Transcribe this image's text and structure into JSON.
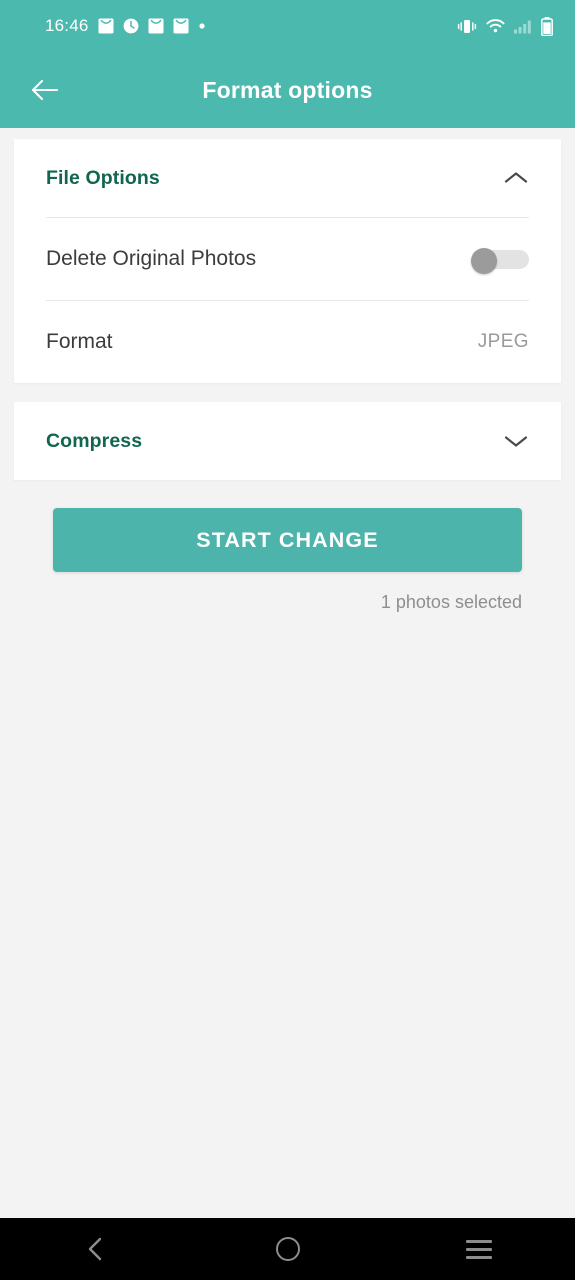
{
  "theme": {
    "accent": "#4cb9af",
    "button": "#4cb4aa",
    "section_title_color": "#10664f",
    "page_bg": "#f3f3f3",
    "card_bg": "#ffffff",
    "nav_bg": "#000000"
  },
  "status_bar": {
    "time": "16:46",
    "left_icons": [
      "mail-icon",
      "clock-icon",
      "mail-icon",
      "mail-icon",
      "dot-icon"
    ],
    "right_icons": [
      "vibrate-icon",
      "wifi-icon",
      "cellular-signal-icon",
      "battery-icon"
    ]
  },
  "app_bar": {
    "back_icon": "arrow-left-icon",
    "title": "Format options"
  },
  "sections": [
    {
      "title": "File Options",
      "expanded": true,
      "chevron_icon": "chevron-up-icon",
      "rows": [
        {
          "label": "Delete Original Photos",
          "control": "toggle",
          "value": "off"
        },
        {
          "label": "Format",
          "control": "value",
          "value": "JPEG"
        }
      ]
    },
    {
      "title": "Compress",
      "expanded": false,
      "chevron_icon": "chevron-down-icon",
      "rows": []
    }
  ],
  "action": {
    "start_label": "START CHANGE",
    "caption": "1 photos selected"
  },
  "nav_bar": {
    "back_icon": "nav-back-icon",
    "home_icon": "nav-home-icon",
    "recents_icon": "nav-recents-icon"
  }
}
